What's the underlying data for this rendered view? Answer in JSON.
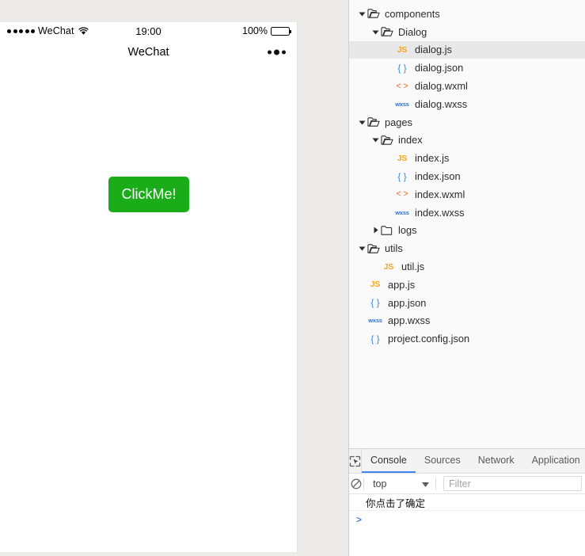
{
  "simulator": {
    "status_bar": {
      "signal_dots": 5,
      "carrier": "WeChat",
      "wifi_icon": "wifi-icon",
      "time": "19:00",
      "battery_percent": "100%",
      "battery_icon": "battery-icon"
    },
    "nav_bar": {
      "title": "WeChat",
      "capsule_icon": "more-dots-icon"
    },
    "page": {
      "button_label": "ClickMe!",
      "button_color": "#1aad19"
    }
  },
  "devtools": {
    "file_tree": [
      {
        "label": "components",
        "type": "folder",
        "state": "open",
        "depth": 0,
        "icon": "folder-open-icon",
        "selected": false
      },
      {
        "label": "Dialog",
        "type": "folder",
        "state": "open",
        "depth": 1,
        "icon": "folder-open-icon",
        "selected": false
      },
      {
        "label": "dialog.js",
        "type": "file",
        "ext": "js",
        "depth": 2,
        "icon": "js-file-icon",
        "selected": true
      },
      {
        "label": "dialog.json",
        "type": "file",
        "ext": "json",
        "depth": 2,
        "icon": "json-file-icon",
        "selected": false
      },
      {
        "label": "dialog.wxml",
        "type": "file",
        "ext": "wxml",
        "depth": 2,
        "icon": "wxml-file-icon",
        "selected": false
      },
      {
        "label": "dialog.wxss",
        "type": "file",
        "ext": "wxss",
        "depth": 2,
        "icon": "wxss-file-icon",
        "selected": false
      },
      {
        "label": "pages",
        "type": "folder",
        "state": "open",
        "depth": 0,
        "icon": "folder-open-icon",
        "selected": false
      },
      {
        "label": "index",
        "type": "folder",
        "state": "open",
        "depth": 1,
        "icon": "folder-open-icon",
        "selected": false
      },
      {
        "label": "index.js",
        "type": "file",
        "ext": "js",
        "depth": 2,
        "icon": "js-file-icon",
        "selected": false
      },
      {
        "label": "index.json",
        "type": "file",
        "ext": "json",
        "depth": 2,
        "icon": "json-file-icon",
        "selected": false
      },
      {
        "label": "index.wxml",
        "type": "file",
        "ext": "wxml",
        "depth": 2,
        "icon": "wxml-file-icon",
        "selected": false
      },
      {
        "label": "index.wxss",
        "type": "file",
        "ext": "wxss",
        "depth": 2,
        "icon": "wxss-file-icon",
        "selected": false
      },
      {
        "label": "logs",
        "type": "folder",
        "state": "closed",
        "depth": 1,
        "icon": "folder-closed-icon",
        "selected": false
      },
      {
        "label": "utils",
        "type": "folder",
        "state": "open",
        "depth": 0,
        "icon": "folder-open-icon",
        "selected": false
      },
      {
        "label": "util.js",
        "type": "file",
        "ext": "js",
        "depth": 1,
        "icon": "js-file-icon",
        "selected": false
      },
      {
        "label": "app.js",
        "type": "file",
        "ext": "js",
        "depth": 0,
        "icon": "js-file-icon",
        "selected": false
      },
      {
        "label": "app.json",
        "type": "file",
        "ext": "json",
        "depth": 0,
        "icon": "json-file-icon",
        "selected": false
      },
      {
        "label": "app.wxss",
        "type": "file",
        "ext": "wxss",
        "depth": 0,
        "icon": "wxss-file-icon",
        "selected": false
      },
      {
        "label": "project.config.json",
        "type": "file",
        "ext": "json",
        "depth": 0,
        "icon": "json-file-icon",
        "selected": false
      }
    ],
    "console": {
      "inspect_icon": "inspect-element-icon",
      "tabs": [
        {
          "label": "Console",
          "active": true
        },
        {
          "label": "Sources",
          "active": false
        },
        {
          "label": "Network",
          "active": false
        },
        {
          "label": "Application",
          "active": false
        }
      ],
      "clear_icon": "clear-console-icon",
      "context": "top",
      "context_caret_icon": "chevron-down-icon",
      "filter_placeholder": "Filter",
      "filter_value": "",
      "messages": [
        "你点击了确定"
      ],
      "prompt": ">"
    },
    "accent_color": "#4285f4"
  }
}
